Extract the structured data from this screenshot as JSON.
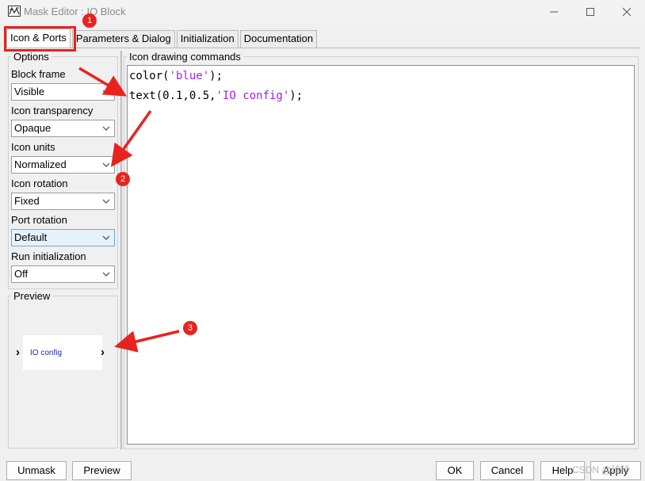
{
  "window": {
    "title": "Mask Editor : IO Block"
  },
  "tabs": [
    {
      "label": "Icon & Ports"
    },
    {
      "label": "Parameters & Dialog"
    },
    {
      "label": "Initialization"
    },
    {
      "label": "Documentation"
    }
  ],
  "options": {
    "group_title": "Options",
    "block_frame": {
      "label": "Block frame",
      "value": "Visible"
    },
    "icon_transparency": {
      "label": "Icon transparency",
      "value": "Opaque"
    },
    "icon_units": {
      "label": "Icon units",
      "value": "Normalized"
    },
    "icon_rotation": {
      "label": "Icon rotation",
      "value": "Fixed"
    },
    "port_rotation": {
      "label": "Port rotation",
      "value": "Default"
    },
    "run_initialization": {
      "label": "Run initialization",
      "value": "Off"
    }
  },
  "preview": {
    "group_title": "Preview",
    "block_text": "IO config",
    "text_color": "#1c2bb3"
  },
  "editor": {
    "title": "Icon drawing commands",
    "lines": [
      {
        "pre": "color(",
        "str": "'blue'",
        "post": ");"
      },
      {
        "pre": "text(0.1,0.5,",
        "str": "'IO config'",
        "post": ");"
      }
    ]
  },
  "buttons": {
    "unmask": "Unmask",
    "preview": "Preview",
    "ok": "OK",
    "cancel": "Cancel",
    "help": "Help",
    "apply": "Apply"
  },
  "annotations": {
    "badges": [
      "1",
      "2",
      "3"
    ],
    "color": "#e8231e"
  },
  "watermark": "CSDN @玲玲"
}
